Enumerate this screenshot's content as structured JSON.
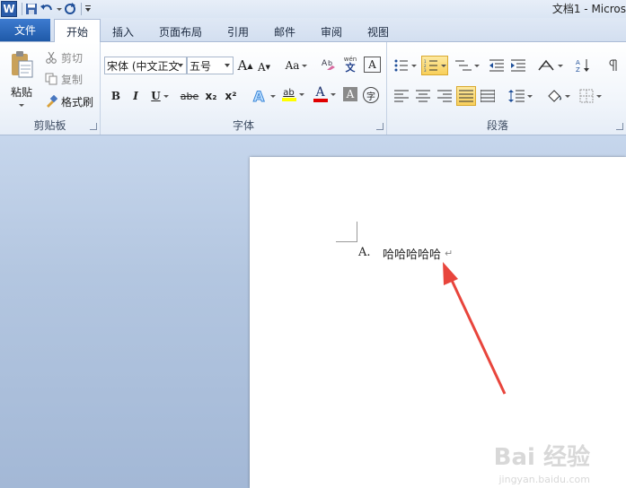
{
  "app": {
    "logo_letter": "W",
    "doc_title": "文档1 - Micros"
  },
  "tabs": {
    "file": "文件",
    "items": [
      "开始",
      "插入",
      "页面布局",
      "引用",
      "邮件",
      "审阅",
      "视图"
    ],
    "active": "开始"
  },
  "clipboard": {
    "paste": "粘贴",
    "cut": "剪切",
    "copy": "复制",
    "format_painter": "格式刷",
    "group_label": "剪贴板"
  },
  "font": {
    "font_name": "宋体 (中文正文",
    "font_size": "五号",
    "group_label": "字体",
    "bold": "B",
    "italic": "I",
    "underline": "U",
    "strike": "abe",
    "subscript": "x₂",
    "superscript": "x²",
    "change_case": "Aa",
    "grow": "A",
    "shrink": "A",
    "phonetic": "wén",
    "char_border": "A",
    "font_color": "A",
    "char_shading": "A",
    "enclose": "字",
    "highlight": "ab"
  },
  "paragraph": {
    "group_label": "段落"
  },
  "document": {
    "list_number": "A.",
    "list_text": "哈哈哈哈哈",
    "para_mark": "↵"
  },
  "watermark": {
    "brand": "Bai 经验",
    "url": "jingyan.baidu.com"
  },
  "colors": {
    "accent": "#2a5caa",
    "arrow": "#e8453c",
    "font_color_bar": "#e00000",
    "highlight_bar": "#ffff00"
  }
}
